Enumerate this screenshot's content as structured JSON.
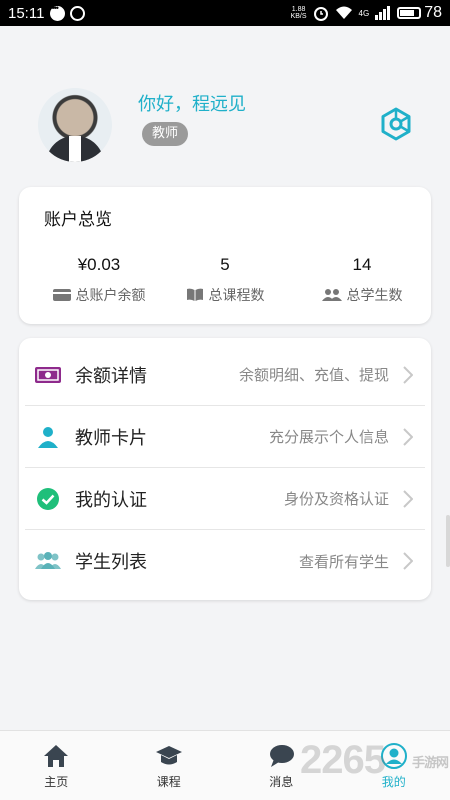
{
  "status_bar": {
    "time": "15:11",
    "speed": "1.88",
    "speed_unit": "KB/S",
    "network": "4G",
    "battery": "78"
  },
  "profile": {
    "greeting": "你好，程远见",
    "role": "教师"
  },
  "overview": {
    "title": "账户总览",
    "stats": [
      {
        "value": "¥0.03",
        "label": "总账户余额",
        "icon": "wallet-icon"
      },
      {
        "value": "5",
        "label": "总课程数",
        "icon": "book-icon"
      },
      {
        "value": "14",
        "label": "总学生数",
        "icon": "people-icon"
      }
    ]
  },
  "menu": {
    "items": [
      {
        "label": "余额详情",
        "subtitle": "余额明细、充值、提现",
        "icon": "money-icon"
      },
      {
        "label": "教师卡片",
        "subtitle": "充分展示个人信息",
        "icon": "person-icon"
      },
      {
        "label": "我的认证",
        "subtitle": "身份及资格认证",
        "icon": "check-circle-icon"
      },
      {
        "label": "学生列表",
        "subtitle": "查看所有学生",
        "icon": "group-icon"
      }
    ]
  },
  "bottom_nav": {
    "items": [
      {
        "label": "主页",
        "icon": "home-icon"
      },
      {
        "label": "课程",
        "icon": "graduation-cap-icon"
      },
      {
        "label": "消息",
        "icon": "chat-icon"
      },
      {
        "label": "我的",
        "icon": "user-icon",
        "active": true
      }
    ]
  },
  "watermark": {
    "text": "2265",
    "sub": "手游网"
  },
  "colors": {
    "accent": "#1fb0c9",
    "badge": "#9a9a9a",
    "money": "#8e2a8c",
    "check": "#1fbf7a"
  }
}
